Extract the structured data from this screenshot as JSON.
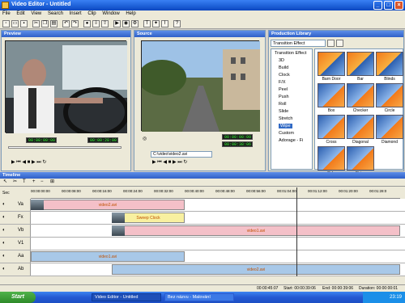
{
  "window": {
    "title": "Video Editor - Untitled"
  },
  "menu": [
    "File",
    "Edit",
    "View",
    "Search",
    "Insert",
    "Clip",
    "Window",
    "Help"
  ],
  "toolbar": {
    "icons": [
      "new-icon",
      "open-icon",
      "save-icon",
      "cut-icon",
      "copy-icon",
      "paste-icon",
      "undo-icon",
      "redo-icon",
      "capture-icon",
      "import-icon",
      "export-icon",
      "render-icon",
      "burn-icon",
      "settings-icon",
      "text-icon",
      "effect-icon",
      "split-icon",
      "help-icon"
    ]
  },
  "preview": {
    "title": "Preview",
    "timecode_left": "00:00:00:00",
    "timecode_right": "00:00:28:00"
  },
  "source": {
    "title": "Source",
    "timecode_left": "00:00:00:00",
    "timecode_right": "00:00:38:06",
    "file": "C:\\video\\video2.avi"
  },
  "library": {
    "title": "Production Library",
    "dropdown": "Transition Effect",
    "tree": [
      "Transition Effect",
      "3D",
      "Build",
      "Clock",
      "F/X",
      "Peel",
      "Push",
      "Roll",
      "Slide",
      "Stretch",
      "Wipe",
      "Custom",
      "Adorage - Fi"
    ],
    "selected_tree": "Wipe",
    "thumbs": [
      "Barn Door",
      "Bar",
      "Blinds",
      "Box",
      "Checker",
      "Circle",
      "Cross",
      "Diagonal",
      "Diamond",
      "Side",
      "Strips"
    ]
  },
  "timeline": {
    "title": "Timeline",
    "marks": [
      "00:00:00:00",
      "00:00:08:00",
      "00:00:16:00",
      "00:00:24:00",
      "00:00:32:00",
      "00:00:40:00",
      "00:00:48:00",
      "00:00:56:00",
      "00:01:04:00",
      "00:01:12:00",
      "00:01:20:00",
      "00:01:28:0"
    ],
    "tracks": [
      {
        "label": "Va",
        "clip": "video2.avi"
      },
      {
        "label": "Fx",
        "clip": "Sweep Clock"
      },
      {
        "label": "Vb",
        "clip": "video1.avi"
      },
      {
        "label": "V1",
        "clip": ""
      },
      {
        "label": "Aa",
        "clip": "video1.avi"
      },
      {
        "label": "Ab",
        "clip": "video2.avi"
      }
    ],
    "label_sec": "Sec",
    "status": {
      "duration_total": "00:00:45:07",
      "start": "Start: 00:00:39:06",
      "end": "End: 00:00:39:06",
      "duration": "Duration: 00:00:00:01"
    }
  },
  "taskbar": {
    "start": "Start",
    "items": [
      "Video Editor - Untitled",
      "Bez názvu - Malování"
    ],
    "clock": "23:19"
  },
  "colors": {
    "title_blue": "#1c5fd6",
    "clip_pink": "#f4c0c8",
    "clip_yellow": "#f8f0a0",
    "clip_blue": "#a8c8e8",
    "start_green": "#3c9a38"
  }
}
